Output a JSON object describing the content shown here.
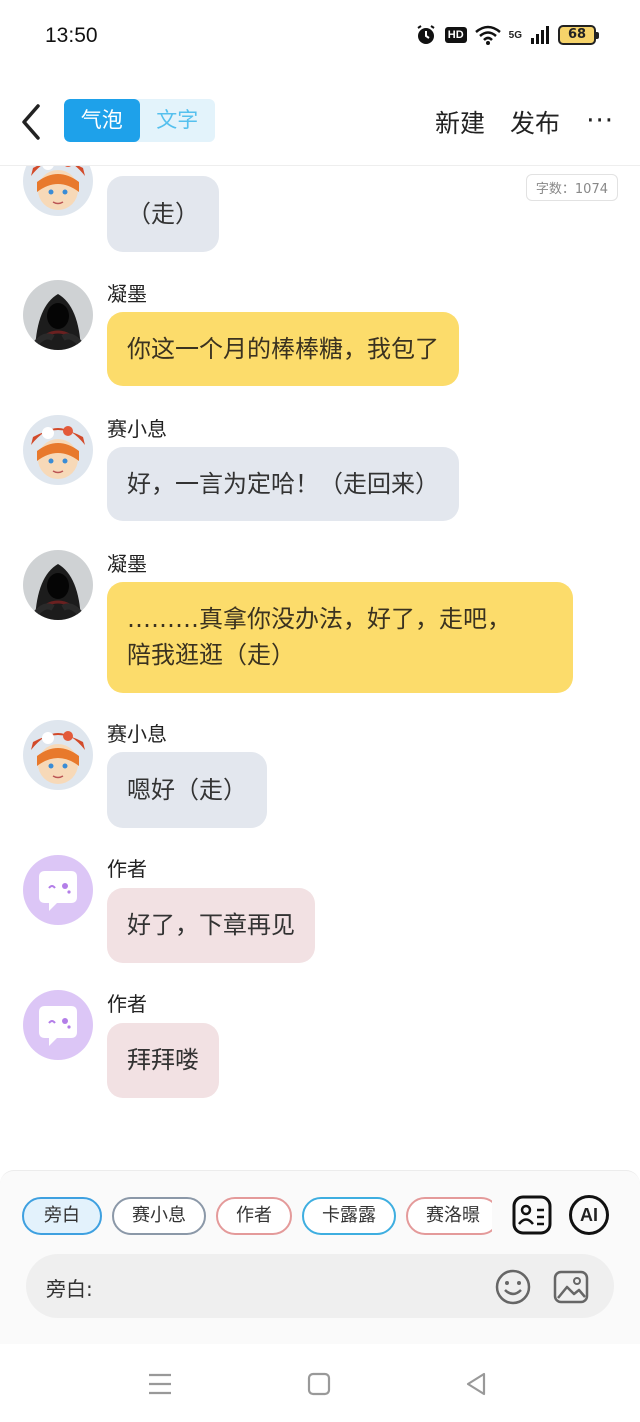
{
  "status": {
    "time": "13:50",
    "battery": "68",
    "hd": "HD",
    "net": "5G"
  },
  "header": {
    "tab_bubble": "气泡",
    "tab_text": "文字",
    "new_label": "新建",
    "publish_label": "发布",
    "more_label": "···"
  },
  "chat": {
    "word_count": "字数：1074",
    "messages": [
      {
        "sender": "",
        "text": "（走）",
        "style": "gray",
        "avatar": "boy-avatar"
      },
      {
        "sender": "凝墨",
        "text": "你这一个月的棒棒糖，我包了",
        "style": "yellow",
        "avatar": "hooded-avatar"
      },
      {
        "sender": "赛小息",
        "text": "好，一言为定哈！（走回来）",
        "style": "gray",
        "avatar": "boy-avatar"
      },
      {
        "sender": "凝墨",
        "text": "………真拿你没办法，好了，走吧，",
        "text2": "陪我逛逛（走）",
        "style": "yellow",
        "avatar": "hooded-avatar"
      },
      {
        "sender": "赛小息",
        "text": "嗯好（走）",
        "style": "gray",
        "avatar": "boy-avatar"
      },
      {
        "sender": "作者",
        "text": "好了，下章再见",
        "style": "pink",
        "avatar": "author-avatar"
      },
      {
        "sender": "作者",
        "text": "拜拜喽",
        "style": "pink",
        "avatar": "author-avatar"
      }
    ]
  },
  "bottom": {
    "chips": [
      "旁白",
      "赛小息",
      "作者",
      "卡露露",
      "赛洛暻"
    ],
    "input_label": "旁白:",
    "input_placeholder": "",
    "ai_label": "AI"
  },
  "colors": {
    "accent": "#1ea1ea",
    "bubble_gray": "#e3e7ee",
    "bubble_yellow": "#fcdc6b",
    "bubble_pink": "#f2e1e3"
  }
}
